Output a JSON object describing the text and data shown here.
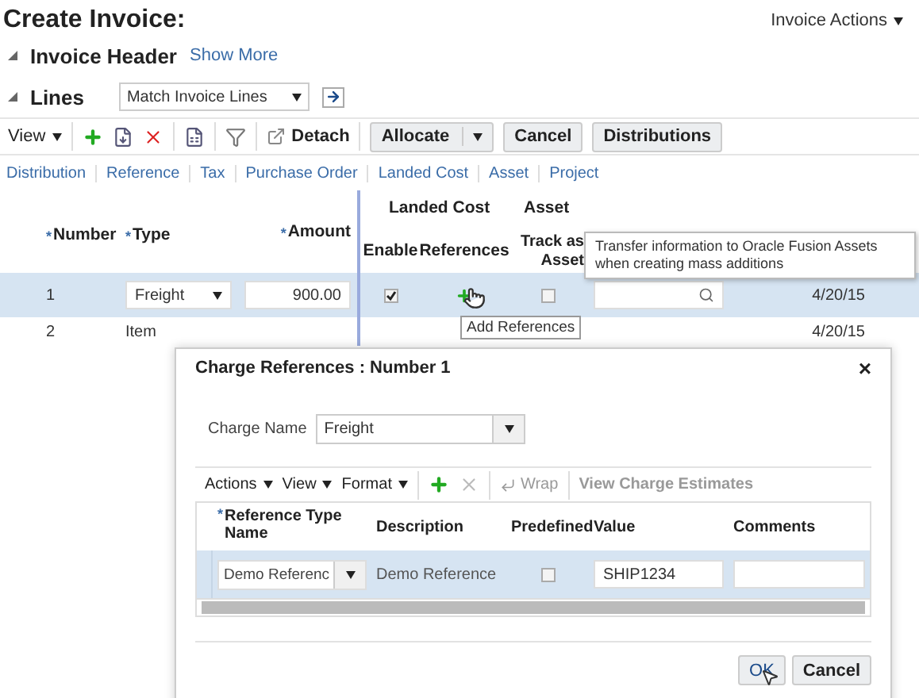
{
  "page": {
    "title": "Create Invoice:",
    "actions_menu": "Invoice Actions"
  },
  "invoice_header": {
    "title": "Invoice Header",
    "expanded": true,
    "link": "Show More"
  },
  "lines": {
    "title": "Lines",
    "expanded": true,
    "select_value": "Match Invoice Lines"
  },
  "toolbar": {
    "view_menu": "View",
    "detach": "Detach",
    "allocate": "Allocate",
    "cancel": "Cancel",
    "distributions": "Distributions"
  },
  "tabs": [
    "Distribution",
    "Reference",
    "Tax",
    "Purchase Order",
    "Landed Cost",
    "Asset",
    "Project"
  ],
  "table": {
    "groups": [
      {
        "label": "Landed Cost"
      },
      {
        "label": "Asset"
      }
    ],
    "required_mark": "*",
    "columns": {
      "number": "Number",
      "type": "Type",
      "amount": "Amount",
      "enable": "Enable",
      "references": "References",
      "track": "Track as Asset"
    },
    "rows": [
      {
        "selected": true,
        "kind": "edit",
        "number": "1",
        "type": "Freight",
        "amount": "900.00",
        "enable": true,
        "track": false,
        "date": "4/20/15"
      },
      {
        "selected": false,
        "kind": "plain",
        "number": "2",
        "type": "Item",
        "date": "4/20/15"
      }
    ]
  },
  "tooltip": "Transfer information to Oracle Fusion Assets when creating mass additions",
  "hover_tip": "Add References",
  "dialog": {
    "title": "Charge References : Number 1",
    "close": "×",
    "charge_label": "Charge Name",
    "charge_value": "Freight",
    "toolbar": {
      "actions": "Actions",
      "view": "View",
      "format": "Format",
      "wrap": "Wrap",
      "estimates": "View Charge Estimates"
    },
    "required_mark": "*",
    "columns": {
      "ref_type": "Reference Type Name",
      "description": "Description",
      "predefined": "Predefined",
      "value": "Value",
      "comments": "Comments"
    },
    "rows": [
      {
        "selected": true,
        "ref_type": "Demo Referenc",
        "description": "Demo Reference",
        "predefined": false,
        "value": "SHIP1234"
      }
    ],
    "buttons": {
      "ok": "OK",
      "cancel": "Cancel"
    }
  }
}
